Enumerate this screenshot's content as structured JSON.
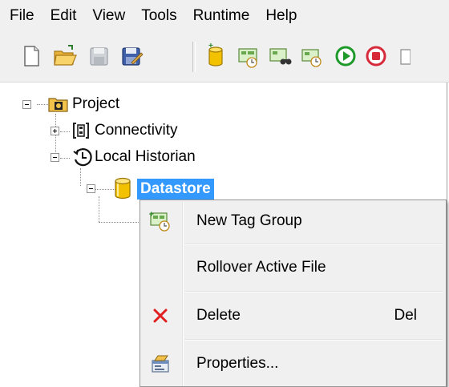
{
  "menubar": {
    "items": [
      "File",
      "Edit",
      "View",
      "Tools",
      "Runtime",
      "Help"
    ]
  },
  "toolbar": {
    "buttons": [
      {
        "icon": "new-file-icon"
      },
      {
        "icon": "open-folder-icon"
      },
      {
        "icon": "save-icon"
      },
      {
        "icon": "save-as-icon"
      },
      {
        "icon": "add-datastore-icon"
      },
      {
        "icon": "add-tag-group-icon"
      },
      {
        "icon": "find-tags-icon"
      },
      {
        "icon": "history-icon"
      },
      {
        "icon": "start-runtime-icon"
      },
      {
        "icon": "stop-runtime-icon"
      }
    ]
  },
  "tree": {
    "project": "Project",
    "connectivity": "Connectivity",
    "historian": "Local Historian",
    "datastore": "Datastore"
  },
  "context_menu": {
    "new_tag_group": "New Tag Group",
    "rollover": "Rollover Active File",
    "delete": "Delete",
    "delete_shortcut": "Del",
    "properties": "Properties..."
  },
  "colors": {
    "selection": "#3399ff",
    "menu_bg": "#f0f0f0",
    "delete_red": "#e02020",
    "datastore_gold": "#f2c200"
  }
}
